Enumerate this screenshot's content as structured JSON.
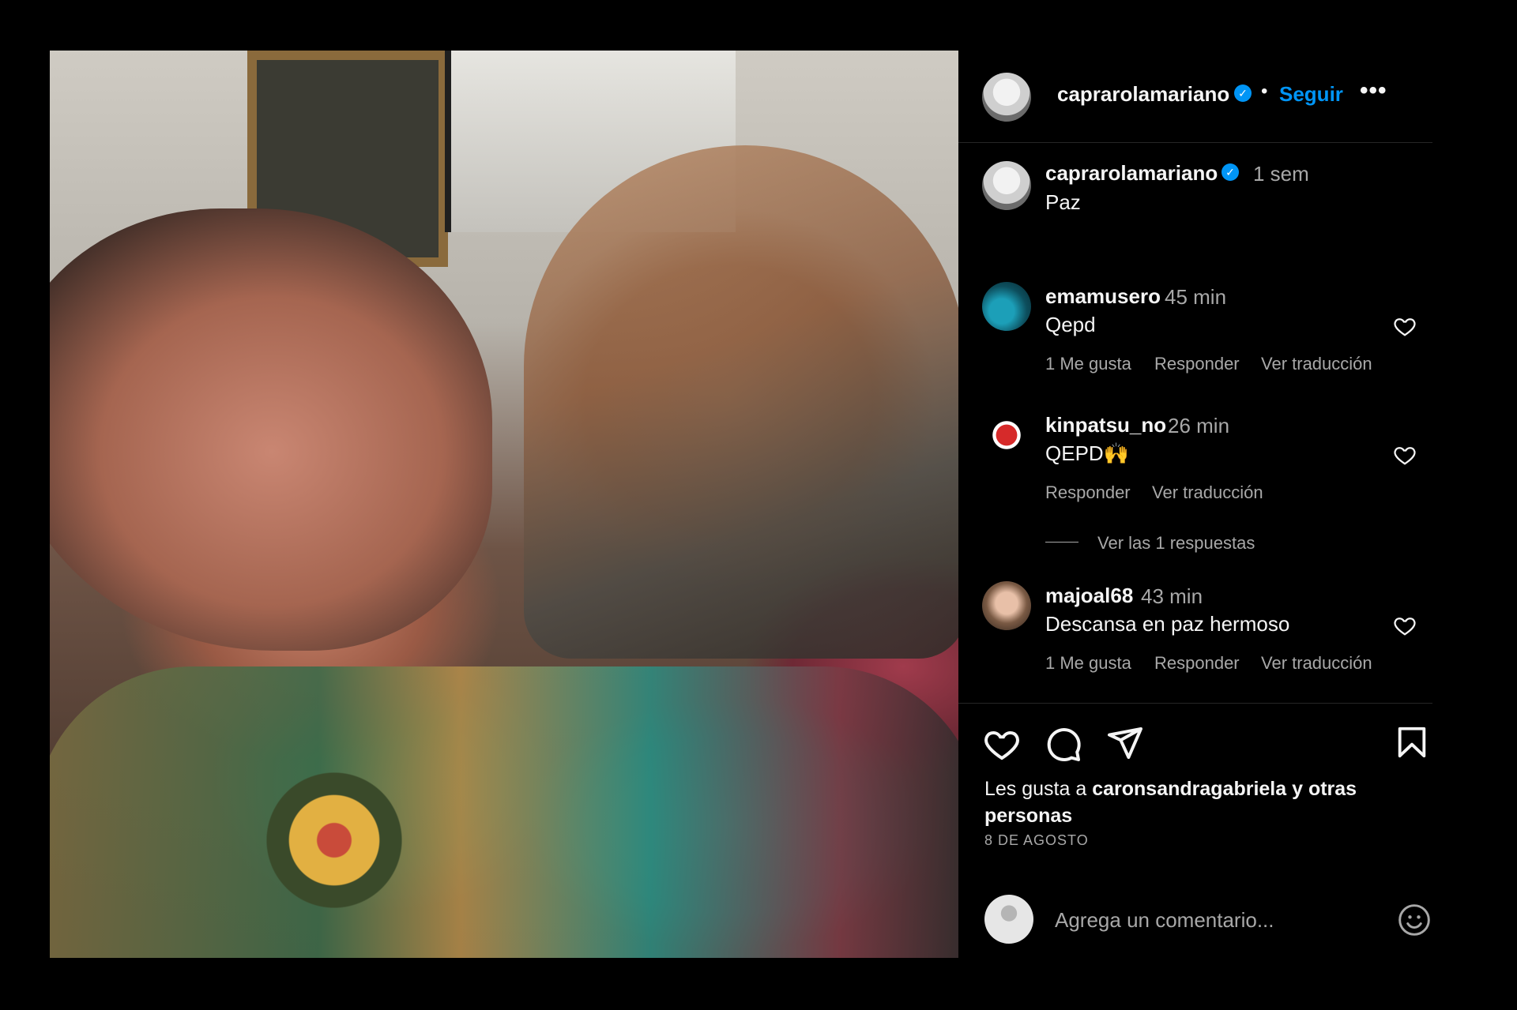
{
  "post": {
    "author": "caprarolamariano",
    "follow_label": "Seguir",
    "caption_time": "1 sem",
    "caption_text": "Paz",
    "likes_prefix": "Les gusta a ",
    "likes_user": "caronsandragabriela",
    "likes_suffix": " y otras personas",
    "date": "8 DE AGOSTO"
  },
  "comments": [
    {
      "user": "emamusero",
      "time": "45 min",
      "text": "Qepd",
      "likes": "1 Me gusta",
      "reply": "Responder",
      "translate": "Ver traducción"
    },
    {
      "user": "kinpatsu_no",
      "time": "26 min",
      "text": "QEPD🙌",
      "reply": "Responder",
      "translate": "Ver traducción",
      "view_replies": "Ver las 1 respuestas"
    },
    {
      "user": "majoal68",
      "time": "43 min",
      "text": "Descansa en paz hermoso",
      "likes": "1 Me gusta",
      "reply": "Responder",
      "translate": "Ver traducción"
    }
  ],
  "comment_box": {
    "placeholder": "Agrega un comentario..."
  },
  "icons": {
    "verified": "verified-badge-icon",
    "more": "more-options-icon",
    "like": "heart-icon",
    "comment": "comment-icon",
    "share": "send-icon",
    "save": "bookmark-icon",
    "emoji": "emoji-icon"
  },
  "colors": {
    "accent": "#0095f6",
    "background": "#000000",
    "muted": "#a8a8a8"
  }
}
